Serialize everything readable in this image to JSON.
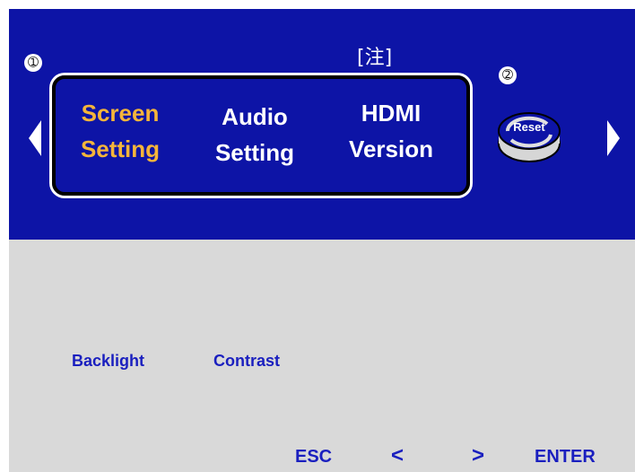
{
  "header": {
    "marker_1": "➀",
    "marker_2": "➁",
    "note": "[注]",
    "tabs": [
      {
        "line1": "Screen",
        "line2": "Setting"
      },
      {
        "line1": "Audio",
        "line2": "Setting"
      },
      {
        "line1": "HDMI",
        "line2": "Version"
      }
    ],
    "active_tab_index": 0,
    "reset_label": "Reset"
  },
  "settings": {
    "items": [
      "Backlight",
      "Contrast"
    ]
  },
  "footer": {
    "esc": "ESC",
    "prev": "<",
    "next": ">",
    "enter": "ENTER"
  },
  "colors": {
    "panel_blue": "#0d14a6",
    "active_orange": "#f5b53a",
    "label_blue": "#1a1fbf",
    "panel_grey": "#d9d9d9"
  }
}
